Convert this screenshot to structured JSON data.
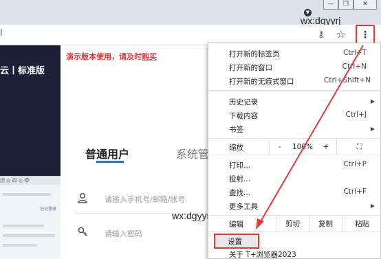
{
  "watermark": "wx:dgyyrj",
  "window": {
    "minimize": "—",
    "restore": "❐",
    "close": "✕",
    "profile": "▼"
  },
  "toolbar": {
    "omnibox_edge": "l",
    "key_icon": "⚷",
    "star_icon": "☆",
    "menu_icon": "⋮"
  },
  "page": {
    "brand": "云丨标准版",
    "notice_pre": "演示版本使用，请及时",
    "notice_link": "购买",
    "tab_user": "普通用户",
    "tab_system": "系统管",
    "phone_placeholder": "请输入手机号/邮箱/账号",
    "password_placeholder": "请输入密码",
    "thumb_bar": "闭 ◎ 四 ◎ 🐵",
    "thumb_link": "忘记登录"
  },
  "menu": {
    "new_tab": "打开新的标签页",
    "new_tab_sc": "Ctrl+T",
    "new_window": "打开新的窗口",
    "new_window_sc": "Ctrl+N",
    "incognito": "打开新的无痕式窗口",
    "incognito_sc": "Ctrl+Shift+N",
    "history": "历史记录",
    "downloads": "下载内容",
    "downloads_sc": "Ctrl+J",
    "bookmarks": "书签",
    "zoom": "缩放",
    "zoom_minus": "-",
    "zoom_value": "100%",
    "zoom_plus": "+",
    "fullscreen": "⛶",
    "print": "打印...",
    "print_sc": "Ctrl+P",
    "cast": "投射...",
    "find": "查找...",
    "find_sc": "Ctrl+F",
    "more_tools": "更多工具",
    "edit": "编辑",
    "cut": "剪切",
    "copy": "复制",
    "paste": "粘贴",
    "settings": "设置",
    "about": "关于 T+浏览器2023"
  },
  "colors": {
    "highlight": "#e53935",
    "brand_panel": "#1f2038",
    "accent": "#2f6fe0"
  }
}
